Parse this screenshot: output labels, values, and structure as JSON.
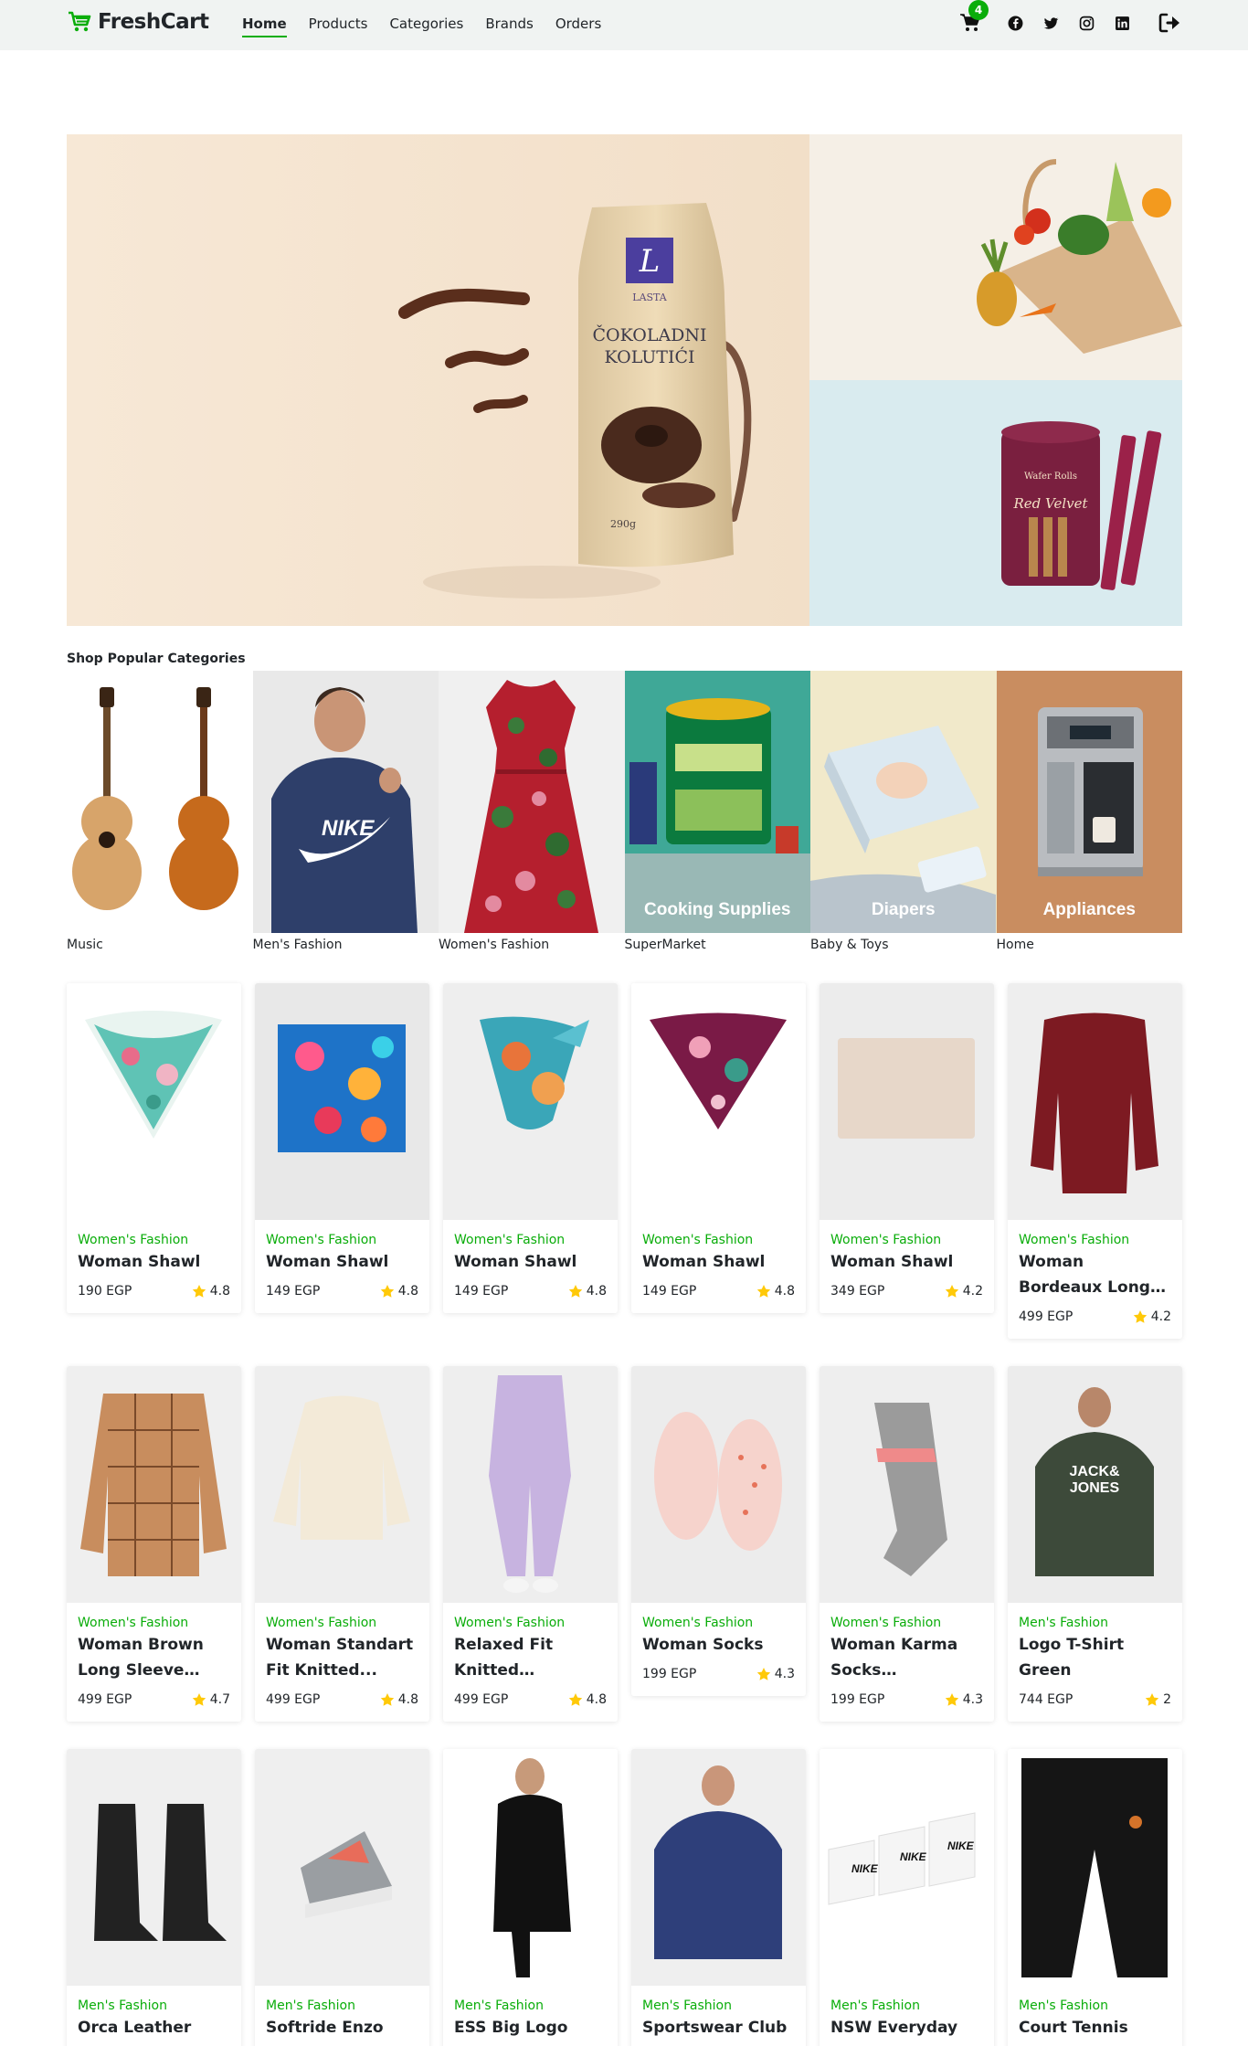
{
  "brand": {
    "name": "FreshCart",
    "accent": "#0aad0a"
  },
  "nav": {
    "links": [
      {
        "label": "Home",
        "active": true
      },
      {
        "label": "Products"
      },
      {
        "label": "Categories"
      },
      {
        "label": "Brands"
      },
      {
        "label": "Orders"
      }
    ],
    "cart_count": "4",
    "socials": [
      "facebook-icon",
      "twitter-icon",
      "instagram-icon",
      "linkedin-icon"
    ],
    "logout_icon": "logout-icon"
  },
  "hero": {
    "main_product": {
      "brand": "LASTA",
      "line1": "ČOKOLADNI",
      "line2": "KOLUTIĆI",
      "weight": "290g"
    },
    "side2_product": {
      "line1": "Wafer Rolls",
      "line2": "Red Velvet"
    }
  },
  "categories": {
    "title": "Shop Popular Categories",
    "items": [
      {
        "name": "Music"
      },
      {
        "name": "Men's Fashion"
      },
      {
        "name": "Women's Fashion"
      },
      {
        "name": "SuperMarket",
        "overlay": "Cooking Supplies"
      },
      {
        "name": "Baby & Toys",
        "overlay": "Diapers"
      },
      {
        "name": "Home",
        "overlay": "Appliances"
      }
    ]
  },
  "products": [
    {
      "category": "Women's Fashion",
      "title": "Woman Shawl",
      "price": "190 EGP",
      "rating": "4.8"
    },
    {
      "category": "Women's Fashion",
      "title": "Woman Shawl",
      "price": "149 EGP",
      "rating": "4.8"
    },
    {
      "category": "Women's Fashion",
      "title": "Woman Shawl",
      "price": "149 EGP",
      "rating": "4.8"
    },
    {
      "category": "Women's Fashion",
      "title": "Woman Shawl",
      "price": "149 EGP",
      "rating": "4.8"
    },
    {
      "category": "Women's Fashion",
      "title": "Woman Shawl",
      "price": "349 EGP",
      "rating": "4.2"
    },
    {
      "category": "Women's Fashion",
      "title": "Woman Bordeaux Long Sleeve Blou...",
      "price": "499 EGP",
      "rating": "4.2"
    },
    {
      "category": "Women's Fashion",
      "title": "Woman Brown Long Sleeve Tuni...",
      "price": "499 EGP",
      "rating": "4.7"
    },
    {
      "category": "Women's Fashion",
      "title": "Woman Standart Fit Knitted...",
      "price": "499 EGP",
      "rating": "4.8"
    },
    {
      "category": "Women's Fashion",
      "title": "Relaxed Fit Knitted Joggers...",
      "price": "499 EGP",
      "rating": "4.8"
    },
    {
      "category": "Women's Fashion",
      "title": "Woman Socks",
      "price": "199 EGP",
      "rating": "4.3"
    },
    {
      "category": "Women's Fashion",
      "title": "Woman Karma Socks Multicolour",
      "price": "199 EGP",
      "rating": "4.3"
    },
    {
      "category": "Men's Fashion",
      "title": "Logo T-Shirt Green",
      "price": "744 EGP",
      "rating": "2"
    },
    {
      "category": "Men's Fashion",
      "title": "Orca Leather",
      "price": "",
      "rating": ""
    },
    {
      "category": "Men's Fashion",
      "title": "Softride Enzo",
      "price": "",
      "rating": ""
    },
    {
      "category": "Men's Fashion",
      "title": "ESS Big Logo",
      "price": "",
      "rating": ""
    },
    {
      "category": "Men's Fashion",
      "title": "Sportswear Club",
      "price": "",
      "rating": ""
    },
    {
      "category": "Men's Fashion",
      "title": "NSW Everyday",
      "price": "",
      "rating": ""
    },
    {
      "category": "Men's Fashion",
      "title": "Court Tennis",
      "price": "",
      "rating": ""
    }
  ]
}
